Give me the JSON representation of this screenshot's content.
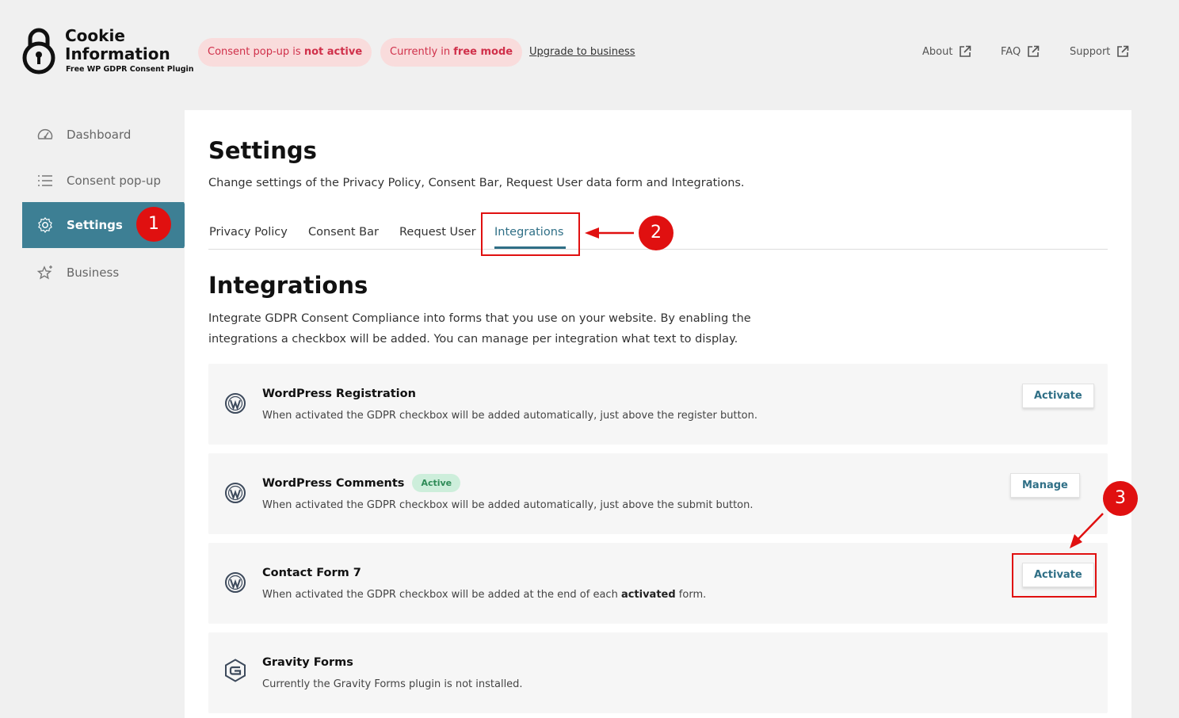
{
  "header": {
    "logo_line1": "Cookie",
    "logo_line2": "Information",
    "logo_sub": "Free WP GDPR Consent Plugin",
    "pill1_prefix": "Consent pop-up is ",
    "pill1_bold": "not active",
    "pill2_prefix": "Currently in ",
    "pill2_bold": "free mode",
    "upgrade": "Upgrade to business",
    "links": [
      {
        "label": "About",
        "icon": "external-link-icon"
      },
      {
        "label": "FAQ",
        "icon": "external-link-icon"
      },
      {
        "label": "Support",
        "icon": "external-link-icon"
      }
    ]
  },
  "sidebar": {
    "items": [
      {
        "label": "Dashboard",
        "icon": "gauge-icon"
      },
      {
        "label": "Consent pop-up",
        "icon": "list-icon"
      },
      {
        "label": "Settings",
        "icon": "gear-icon",
        "active": true
      },
      {
        "label": "Business",
        "icon": "star-icon"
      }
    ]
  },
  "main": {
    "title": "Settings",
    "description": "Change settings of the Privacy Policy, Consent Bar, Request User data form and Integrations.",
    "tabs": [
      {
        "label": "Privacy Policy"
      },
      {
        "label": "Consent Bar"
      },
      {
        "label": "Request User"
      },
      {
        "label": "Integrations",
        "active": true
      }
    ],
    "section_title": "Integrations",
    "section_desc": "Integrate GDPR Consent Compliance into forms that you use on your website. By enabling the integrations a checkbox will be added. You can manage per integration what text to display.",
    "integrations": [
      {
        "title": "WordPress Registration",
        "desc": "When activated the GDPR checkbox will be added automatically, just above the register button.",
        "button": "Activate",
        "icon": "wordpress-icon"
      },
      {
        "title": "WordPress Comments",
        "badge": "Active",
        "desc": "When activated the GDPR checkbox will be added automatically, just above the submit button.",
        "button": "Manage",
        "icon": "wordpress-icon"
      },
      {
        "title": "Contact Form 7",
        "desc_pre": "When activated the GDPR checkbox will be added at the end of each ",
        "desc_bold": "activated",
        "desc_post": " form.",
        "button": "Activate",
        "icon": "wordpress-icon"
      },
      {
        "title": "Gravity Forms",
        "desc": "Currently the Gravity Forms plugin is not installed.",
        "icon": "gravity-forms-icon"
      }
    ]
  },
  "annotations": {
    "step1": "1",
    "step2": "2",
    "step3": "3",
    "color": "#e01010"
  },
  "colors": {
    "accent": "#3d7f94",
    "tab_active": "#2f6f86",
    "pill_bg": "#f9dcdc",
    "pill_text": "#d0304a",
    "badge_bg": "#cdeedb",
    "badge_text": "#2e8b57"
  }
}
